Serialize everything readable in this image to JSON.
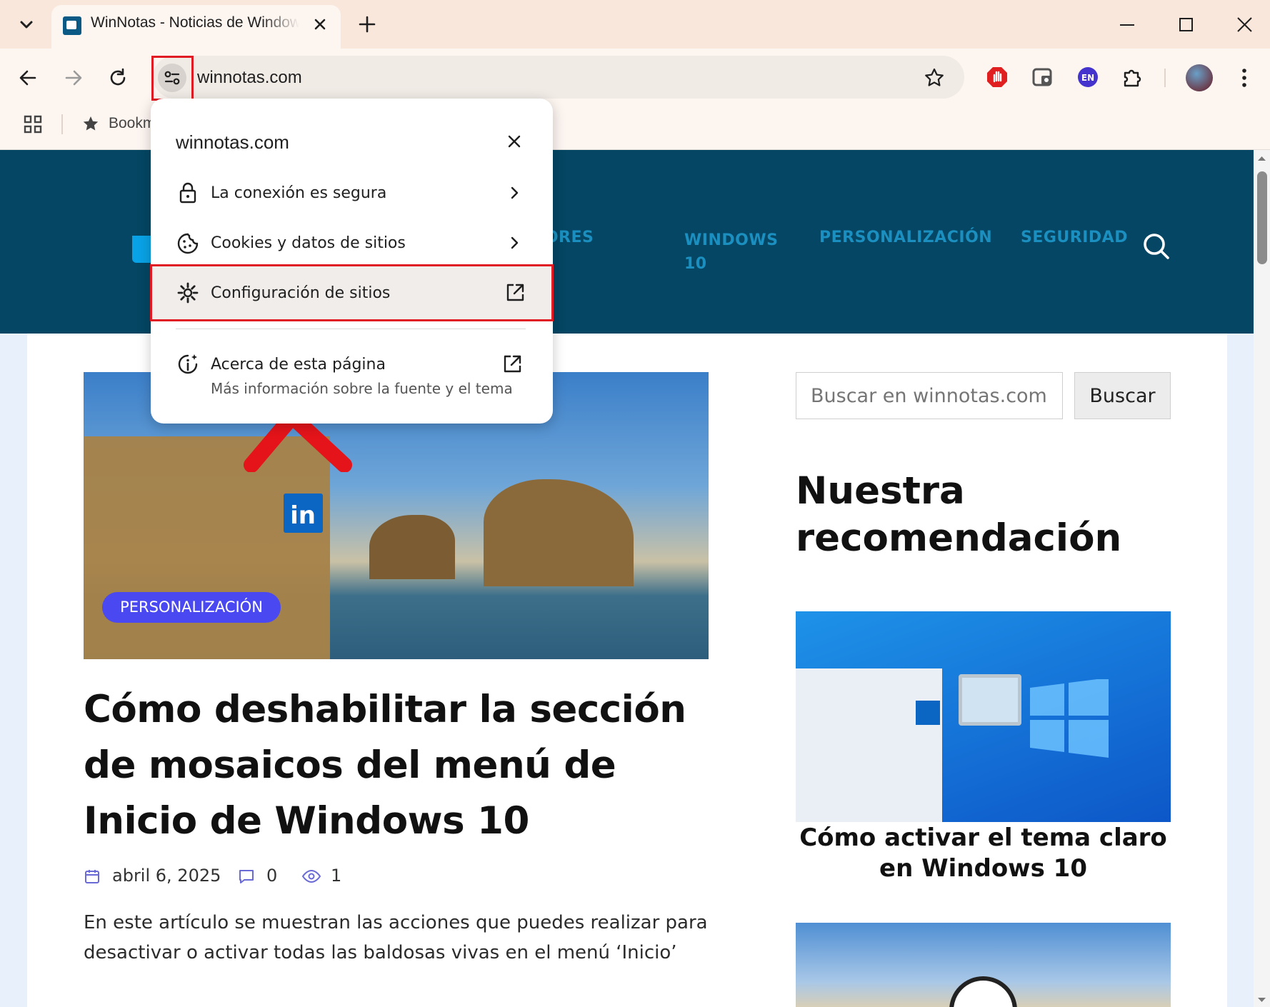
{
  "browser": {
    "tab_title": "WinNotas - Noticias de Windows",
    "url": "winnotas.com",
    "bookmark_label": "Bookmarks"
  },
  "site": {
    "nav": [
      {
        "label": "NAVEGADORES"
      },
      {
        "label": "WINDOWS 10"
      },
      {
        "label": "PERSONALIZACIÓN"
      },
      {
        "label": "SEGURIDAD"
      }
    ],
    "hero_badge": "PERSONALIZACIÓN",
    "article": {
      "title": "Cómo deshabilitar la sección de mosaicos del menú de Inicio de Windows 10",
      "date": "abril 6, 2025",
      "comments": "0",
      "views": "1",
      "excerpt": "En este artículo se muestran las acciones que puedes realizar para desactivar o activar todas las baldosas vivas en el menú ‘Inicio’"
    },
    "sidebar": {
      "search_placeholder": "Buscar en winnotas.com",
      "search_button": "Buscar",
      "reco_heading": "Nuestra recomendación",
      "reco_title": "Cómo activar el tema claro en Windows 10"
    }
  },
  "popup": {
    "title": "winnotas.com",
    "items": [
      {
        "label": "La conexión es segura"
      },
      {
        "label": "Cookies y datos de sitios"
      },
      {
        "label": "Configuración de sitios"
      },
      {
        "label": "Acerca de esta página",
        "sublabel": "Más información sobre la fuente y el tema"
      }
    ]
  },
  "colors": {
    "header_bg": "#044663",
    "nav_text": "#1b8fbf",
    "badge_bg": "#4a49f1",
    "highlight": "#e01b24"
  }
}
